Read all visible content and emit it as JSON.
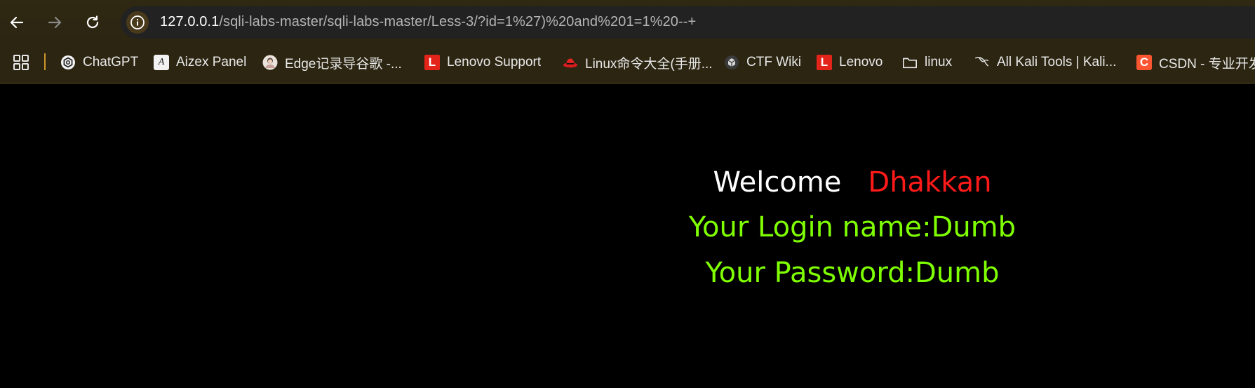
{
  "browser": {
    "url_host": "127.0.0.1",
    "url_path": "/sqli-labs-master/sqli-labs-master/Less-3/?id=1%27)%20and%201=1%20--+",
    "nav": {
      "back_icon": "arrow-left-icon",
      "forward_icon": "arrow-right-icon",
      "reload_icon": "reload-icon",
      "site_info_icon": "info-icon"
    }
  },
  "bookmarks": {
    "apps_icon": "apps-grid-icon",
    "items": [
      {
        "label": "ChatGPT",
        "icon": "chatgpt-icon"
      },
      {
        "label": "Aizex Panel",
        "icon": "aizex-icon"
      },
      {
        "label": "Edge记录导谷歌 -...",
        "icon": "avatar-icon"
      },
      {
        "label": "Lenovo Support",
        "icon": "lenovo-icon",
        "icon_text": "L"
      },
      {
        "label": "Linux命令大全(手册...",
        "icon": "redhat-icon"
      },
      {
        "label": "CTF Wiki",
        "icon": "ctf-wiki-icon"
      },
      {
        "label": "Lenovo",
        "icon": "lenovo-icon",
        "icon_text": "L"
      },
      {
        "label": "linux",
        "icon": "folder-icon"
      },
      {
        "label": "All Kali Tools | Kali...",
        "icon": "kali-icon"
      },
      {
        "label": "CSDN - 专业开发",
        "icon": "csdn-icon",
        "icon_text": "C"
      }
    ]
  },
  "page": {
    "welcome": "Welcome",
    "user": "Dhakkan",
    "login_line": "Your Login name:Dumb",
    "password_line": "Your Password:Dumb"
  },
  "colors": {
    "toolbar_bg": "#2f2813",
    "page_bg": "#000000",
    "welcome": "#ffffff",
    "user": "#ff1a1a",
    "result_text": "#7fff00"
  }
}
